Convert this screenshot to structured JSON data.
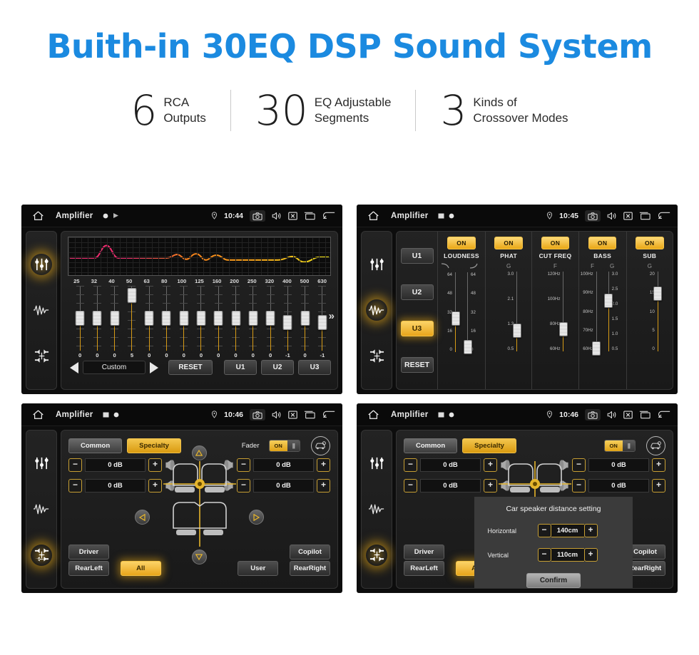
{
  "header": {
    "title": "Buith-in 30EQ DSP Sound System",
    "title_color": "#1b8ae0",
    "stats": [
      {
        "number": "6",
        "text": "RCA\nOutputs"
      },
      {
        "number": "30",
        "text": "EQ Adjustable\nSegments"
      },
      {
        "number": "3",
        "text": "Kinds of\nCrossover Modes"
      }
    ]
  },
  "accent_color": "#e8a51b",
  "statusbar_common": {
    "app_title": "Amplifier",
    "icons": [
      "home-icon",
      "location-pin-icon",
      "camera-icon",
      "volume-icon",
      "close-box-icon",
      "recent-apps-icon",
      "back-icon"
    ]
  },
  "panel1": {
    "statusbar": {
      "title": "Amplifier",
      "time": "10:44"
    },
    "sidebar": [
      {
        "name": "equalizer-icon",
        "active": true
      },
      {
        "name": "waveform-icon",
        "active": false
      },
      {
        "name": "balance-icon",
        "active": false
      }
    ],
    "curve_colors": [
      "#ef2b6e",
      "#f07d1a",
      "#ece018"
    ],
    "frequencies": [
      "25",
      "32",
      "40",
      "50",
      "63",
      "80",
      "100",
      "125",
      "160",
      "200",
      "250",
      "320",
      "400",
      "500",
      "630"
    ],
    "values": [
      "0",
      "0",
      "0",
      "5",
      "0",
      "0",
      "0",
      "0",
      "0",
      "0",
      "0",
      "0",
      "-1",
      "0",
      "-1"
    ],
    "more_chevron": "»",
    "prev_arrow": "prev-preset-arrow",
    "preset_name": "Custom",
    "next_arrow": "next-preset-arrow",
    "reset_label": "RESET",
    "user_presets": [
      "U1",
      "U2",
      "U3"
    ]
  },
  "panel2": {
    "statusbar": {
      "title": "Amplifier",
      "time": "10:45"
    },
    "sidebar": [
      {
        "name": "equalizer-icon",
        "active": false
      },
      {
        "name": "waveform-icon",
        "active": true
      },
      {
        "name": "balance-icon",
        "active": false
      }
    ],
    "preset_buttons": [
      {
        "label": "U1",
        "active": false
      },
      {
        "label": "U2",
        "active": false
      },
      {
        "label": "U3",
        "active": true
      }
    ],
    "reset_label": "RESET",
    "sections": [
      {
        "title": "LOUDNESS",
        "toggle": "ON",
        "sub_labels": [
          "curve-down-icon",
          "curve-up-icon"
        ],
        "sliders": [
          {
            "scale": [
              "64",
              "48",
              "32",
              "16",
              "0"
            ],
            "pos_pct": 42
          },
          {
            "scale": [
              "64",
              "48",
              "32",
              "16",
              "0"
            ],
            "pos_pct": 6
          }
        ]
      },
      {
        "title": "PHAT",
        "toggle": "ON",
        "sub_labels": [
          "G"
        ],
        "sliders": [
          {
            "scale": [
              "3.0",
              "2.1",
              "1.3",
              "0.5"
            ],
            "pos_pct": 26
          }
        ]
      },
      {
        "title": "CUT FREQ",
        "toggle": "ON",
        "sub_labels": [
          "F"
        ],
        "sliders": [
          {
            "scale": [
              "120Hz",
              "100Hz",
              "80Hz",
              "60Hz"
            ],
            "pos_pct": 28
          }
        ]
      },
      {
        "title": "BASS",
        "toggle": "ON",
        "sub_labels": [
          "F",
          "G"
        ],
        "sliders": [
          {
            "scale": [
              "100Hz",
              "90Hz",
              "80Hz",
              "70Hz",
              "60Hz"
            ],
            "pos_pct": 4
          },
          {
            "scale": [
              "3.0",
              "2.5",
              "2.0",
              "1.5",
              "1.0",
              "0.5"
            ],
            "pos_pct": 63
          }
        ]
      },
      {
        "title": "SUB",
        "toggle": "ON",
        "sub_labels": [
          "G"
        ],
        "sliders": [
          {
            "scale": [
              "20",
              "15",
              "10",
              "5",
              "0"
            ],
            "pos_pct": 72
          }
        ]
      }
    ]
  },
  "panel3": {
    "statusbar": {
      "title": "Amplifier",
      "time": "10:46"
    },
    "sidebar": [
      {
        "name": "equalizer-icon",
        "active": false
      },
      {
        "name": "waveform-icon",
        "active": false
      },
      {
        "name": "balance-icon",
        "active": true
      }
    ],
    "tabs": [
      {
        "label": "Common",
        "active": false
      },
      {
        "label": "Specialty",
        "active": true
      }
    ],
    "fader_label": "Fader",
    "fader_toggle": "ON",
    "car_setting_icon": "car-settings-icon",
    "gains": [
      {
        "position": "front-left",
        "value": "0 dB",
        "minus": "−",
        "plus": "+"
      },
      {
        "position": "front-right",
        "value": "0 dB",
        "minus": "−",
        "plus": "+"
      },
      {
        "position": "rear-left",
        "value": "0 dB",
        "minus": "−",
        "plus": "+"
      },
      {
        "position": "rear-right",
        "value": "0 dB",
        "minus": "−",
        "plus": "+"
      }
    ],
    "seat_buttons_row1": [
      {
        "label": "Driver",
        "active": false
      },
      {
        "label": "Copilot",
        "active": false
      }
    ],
    "seat_buttons_row2": [
      {
        "label": "RearLeft",
        "active": false
      },
      {
        "label": "All",
        "active": true
      },
      {
        "label": "User",
        "active": false
      },
      {
        "label": "RearRight",
        "active": false
      }
    ]
  },
  "panel4": {
    "statusbar": {
      "title": "Amplifier",
      "time": "10:46"
    },
    "modal": {
      "title": "Car speaker distance setting",
      "rows": [
        {
          "label": "Horizontal",
          "value": "140cm",
          "minus": "−",
          "plus": "+"
        },
        {
          "label": "Vertical",
          "value": "110cm",
          "minus": "−",
          "plus": "+"
        }
      ],
      "confirm_label": "Confirm"
    }
  }
}
